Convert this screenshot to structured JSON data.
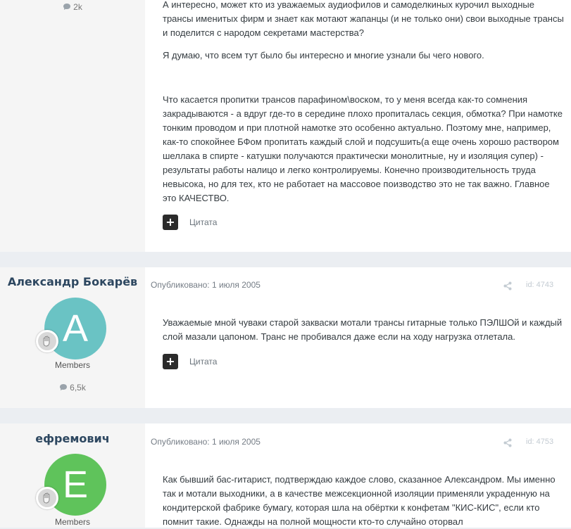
{
  "posts": [
    {
      "author_stat": "2k",
      "paragraphs": [
        "А интересно, может кто из уважаемых аудиофилов и самоделкиных курочил выходные трансы именитых фирм и знает как мотают жапанцы (и не только они) свои выходные трансы и поделится с народом секретами мастерства?",
        "Я думаю, что всем тут было бы интересно и многие узнали бы чего нового.",
        "Что касается пропитки трансов парафином\\воском, то у меня всегда как-то сомнения закрадываются - а вдруг где-то в середине плохо пропиталась секция, обмотка? При намотке тонким проводом и при плотной намотке это особенно актуально. Поэтому мне, например, как-то спокойнее БФом пропитать каждый слой и подсушить(а еще очень хорошо раствором шеллака в спирте - катушки получаются практически монолитные, ну и изоляция супер) - результаты работы налицо и легко контролируемы. Конечно производительность труда невысока, но для тех, кто не работает на массовое поизводство это не так важно. Главное это КАЧЕСТВО."
      ],
      "quote_icon": "+",
      "quote_label": "Цитата"
    },
    {
      "author_name": "Александр Бокарёв",
      "avatar_letter": "A",
      "avatar_color": "#6ac3c4",
      "group": "Members",
      "author_stat": "6,5k",
      "published": "Опубликовано: 1 июля 2005",
      "post_id": "id: 4743",
      "paragraphs": [
        "Уважаемые мной чуваки старой закваски мотали трансы гитарные только ПЭЛШОй и каждый слой мазали цапоном. Транс не пробивался даже если на ходу нагрузка отлетала."
      ],
      "quote_icon": "+",
      "quote_label": "Цитата"
    },
    {
      "author_name": "ефремович",
      "avatar_letter": "E",
      "avatar_color": "#5fc35b",
      "group": "Members",
      "published": "Опубликовано: 1 июля 2005",
      "post_id": "id: 4753",
      "paragraphs": [
        "Как бывший бас-гитарист, подтверждаю каждое слово, сказанное Александром. Мы именно так и мотали выходники, а в качестве межсекционной изоляции применяли украденную на кондитерской фабрике бумагу, которая шла на обёртки к конфетам \"КИС-КИС\", если кто помнит такие. Однажды на полной мощности кто-то случайно оторвал"
      ]
    }
  ]
}
